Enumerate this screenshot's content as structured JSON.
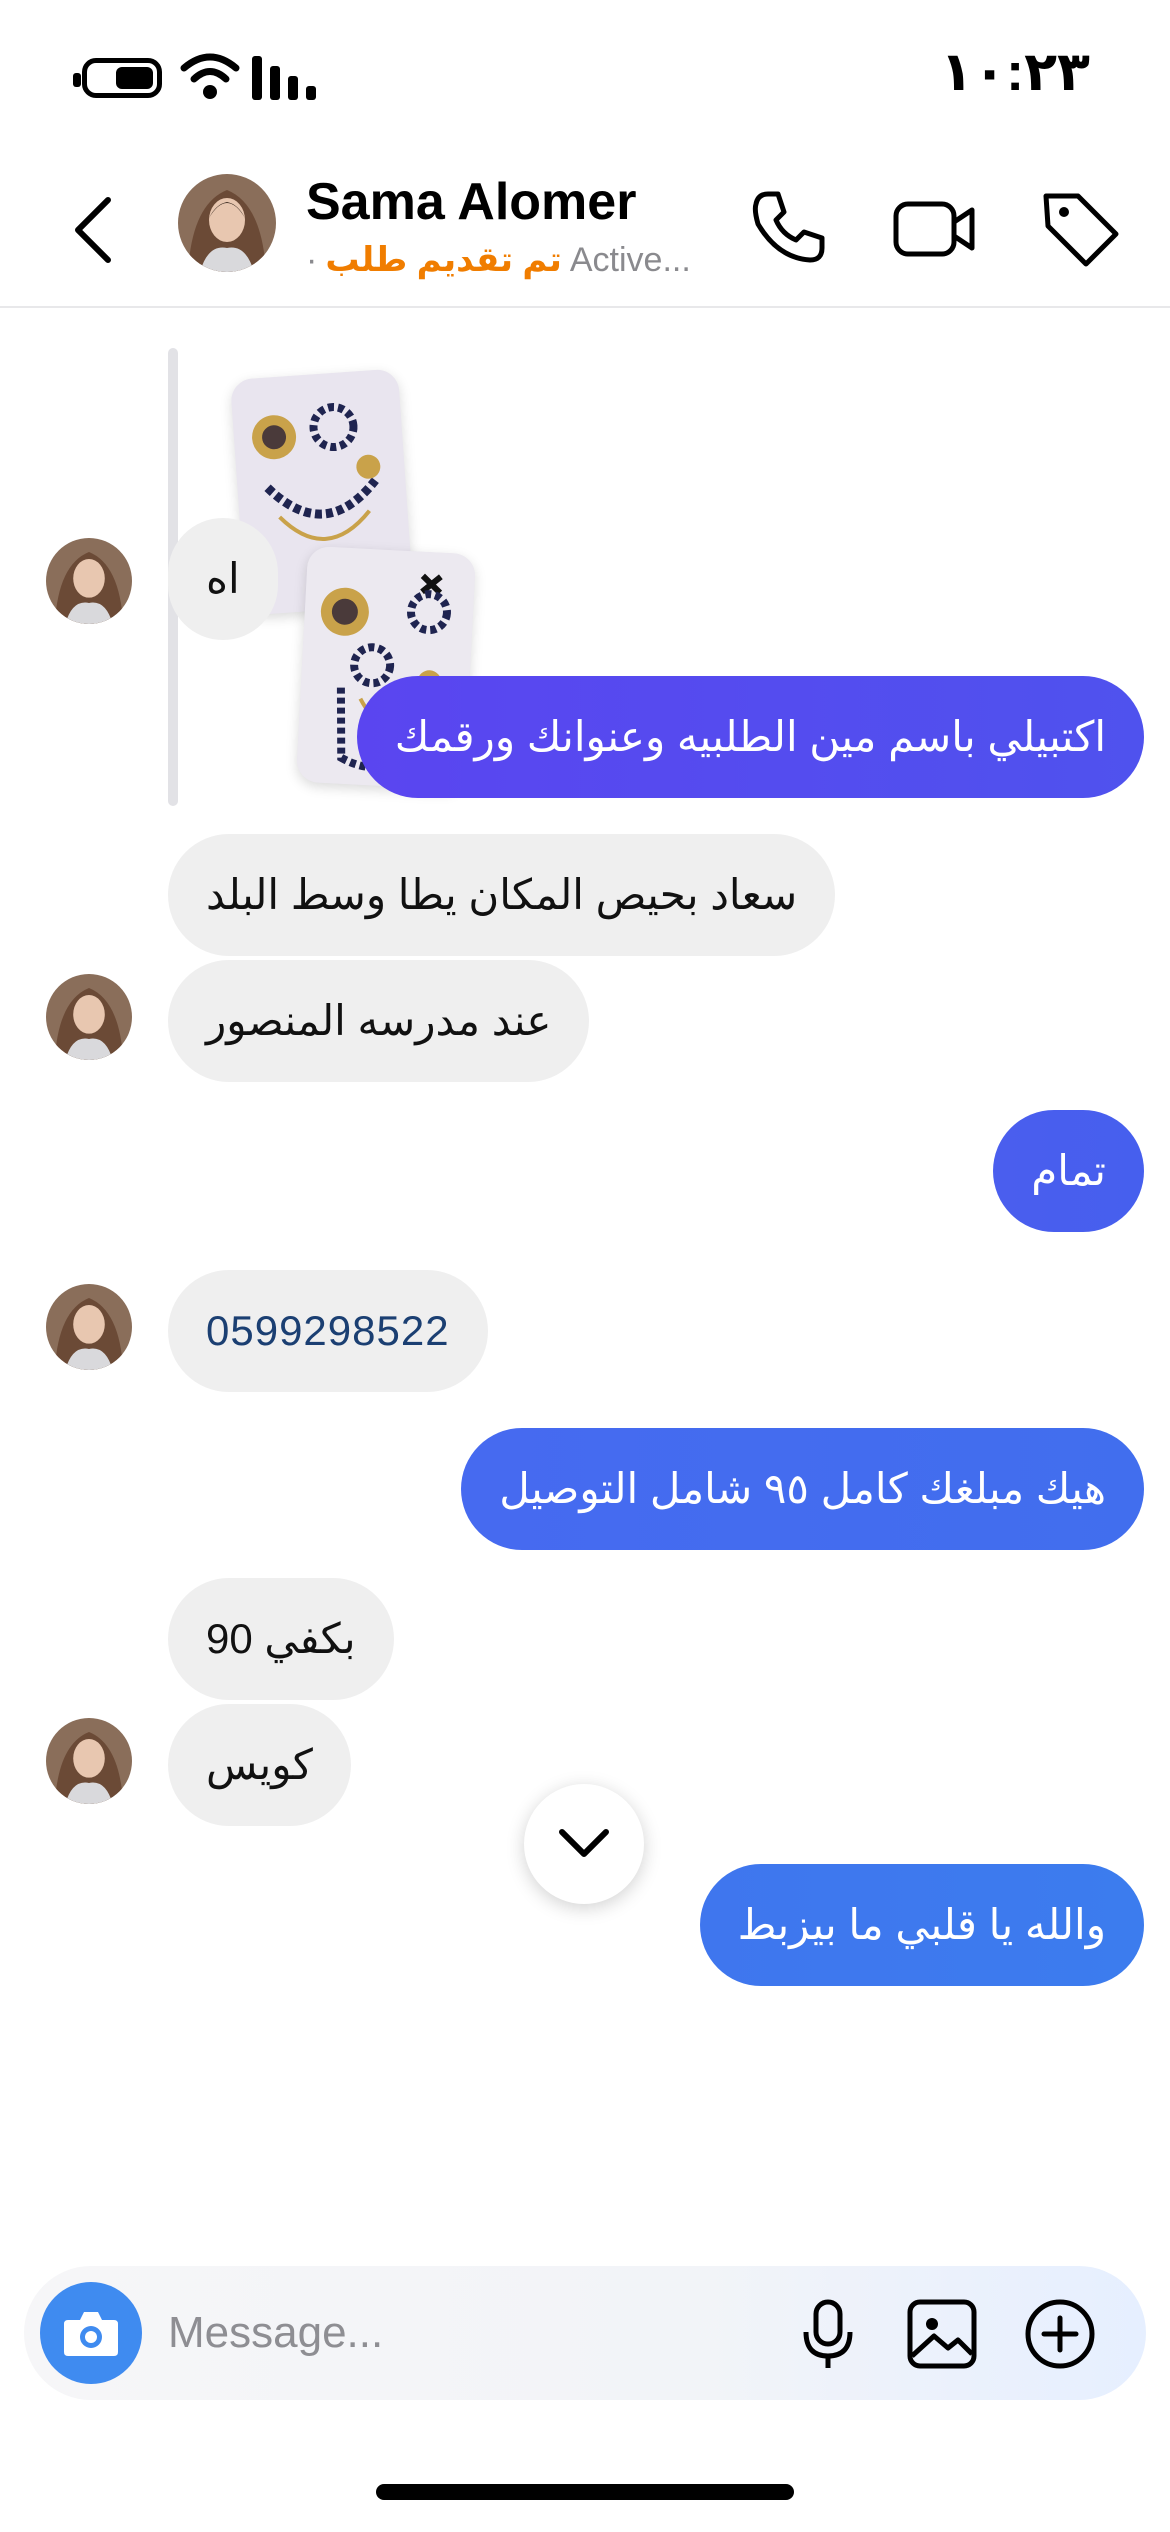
{
  "status_bar": {
    "time": "١٠:٢٣",
    "battery_icon": "battery-icon",
    "wifi_icon": "wifi-icon",
    "signal_icon": "signal-icon"
  },
  "header": {
    "contact_name": "Sama Alomer",
    "order_tag": "تم تقديم طلب",
    "separator": "·",
    "activity": "Active...",
    "icons": [
      "back-icon",
      "phone-icon",
      "video-camera-icon",
      "tag-icon"
    ]
  },
  "colors": {
    "order_tag": "#f07d00",
    "incoming_bubble": "#efefef",
    "outgoing_gradient": [
      "#5a45f0",
      "#4a60ee",
      "#3f78ee"
    ],
    "camera_button": "#3f8bf0",
    "phone_link": "#1b3f72"
  },
  "messages": [
    {
      "sender": "them",
      "type": "image",
      "content": "product-photos"
    },
    {
      "sender": "them",
      "text": "اه"
    },
    {
      "sender": "me",
      "text": "اكتبيلي باسم مين الطلبيه وعنوانك ورقمك"
    },
    {
      "sender": "them",
      "text": "سعاد بحيص المكان يطا وسط البلد"
    },
    {
      "sender": "them",
      "text": "عند مدرسه المنصور"
    },
    {
      "sender": "me",
      "text": "تمام"
    },
    {
      "sender": "them",
      "text": "0599298522"
    },
    {
      "sender": "me",
      "text": "هيك مبلغك كامل ٩٥ شامل التوصيل"
    },
    {
      "sender": "them",
      "text": "بكفي 90"
    },
    {
      "sender": "them",
      "text": "كويس"
    },
    {
      "sender": "me",
      "text": "والله يا قلبي ما بيزبط"
    }
  ],
  "composer": {
    "placeholder": "Message...",
    "icons": [
      "camera-icon",
      "microphone-icon",
      "gallery-icon",
      "plus-icon"
    ]
  }
}
